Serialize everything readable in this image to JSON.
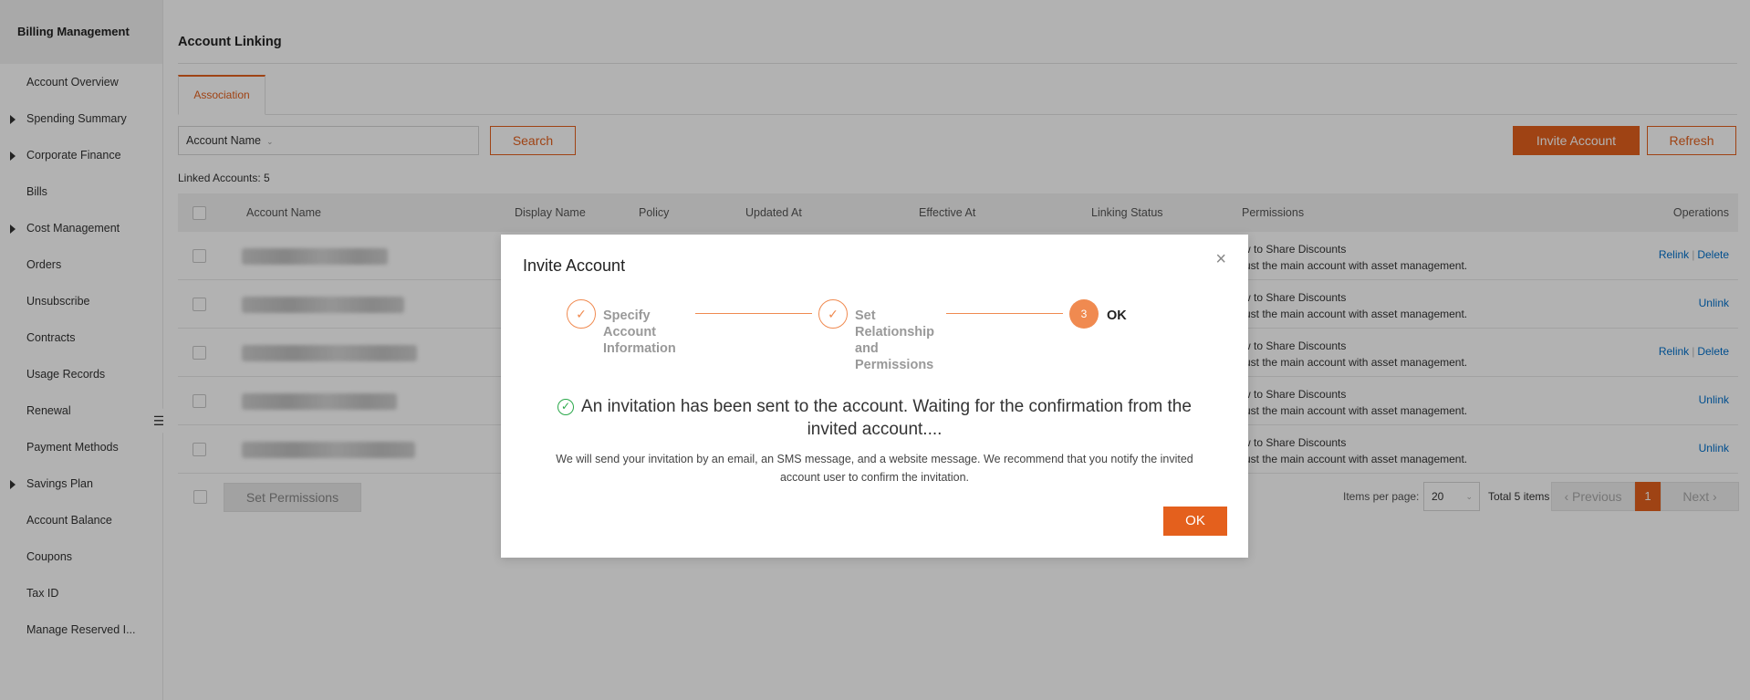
{
  "sidebar": {
    "title": "Billing Management",
    "items": [
      {
        "label": "Account Overview",
        "expandable": false
      },
      {
        "label": "Spending Summary",
        "expandable": true
      },
      {
        "label": "Corporate Finance",
        "expandable": true
      },
      {
        "label": "Bills",
        "expandable": false
      },
      {
        "label": "Cost Management",
        "expandable": true
      },
      {
        "label": "Orders",
        "expandable": false
      },
      {
        "label": "Unsubscribe",
        "expandable": false
      },
      {
        "label": "Contracts",
        "expandable": false
      },
      {
        "label": "Usage Records",
        "expandable": false
      },
      {
        "label": "Renewal",
        "expandable": false
      },
      {
        "label": "Payment Methods",
        "expandable": false
      },
      {
        "label": "Savings Plan",
        "expandable": true
      },
      {
        "label": "Account Balance",
        "expandable": false
      },
      {
        "label": "Coupons",
        "expandable": false
      },
      {
        "label": "Tax ID",
        "expandable": false
      },
      {
        "label": "Manage Reserved I...",
        "expandable": false
      }
    ]
  },
  "main": {
    "title": "Account Linking",
    "tab": "Association",
    "filter_select": "Account Name",
    "search_label": "Search",
    "invite_label": "Invite Account",
    "refresh_label": "Refresh",
    "linked_count": "Linked Accounts: 5",
    "columns": {
      "account_name": "Account Name",
      "display_name": "Display Name",
      "policy": "Policy",
      "updated_at": "Updated At",
      "effective_at": "Effective At",
      "linking_status": "Linking Status",
      "permissions": "Permissions",
      "operations": "Operations"
    },
    "rows": [
      {
        "perm1": "llow to Share Discounts",
        "perm2": "ntrust the main account with asset management.",
        "op1": "Relink",
        "op2": "Delete"
      },
      {
        "perm1": "llow to Share Discounts",
        "perm2": "ntrust the main account with asset management.",
        "op1": "Unlink",
        "op2": ""
      },
      {
        "perm1": "llow to Share Discounts",
        "perm2": "ntrust the main account with asset management.",
        "op1": "Relink",
        "op2": "Delete"
      },
      {
        "perm1": "llow to Share Discounts",
        "perm2": "ntrust the main account with asset management.",
        "op1": "Unlink",
        "op2": ""
      },
      {
        "perm1": "llow to Share Discounts",
        "perm2": "ntrust the main account with asset management.",
        "op1": "Unlink",
        "op2": ""
      }
    ],
    "set_permissions_label": "Set Permissions",
    "items_per_page_label": "Items per page:",
    "items_per_page_value": "20",
    "total_items": "Total 5 items",
    "prev_label": "Previous",
    "next_label": "Next",
    "current_page": "1"
  },
  "modal": {
    "title": "Invite Account",
    "close_glyph": "×",
    "steps": [
      {
        "label": "Specify Account Information",
        "state": "done"
      },
      {
        "label": "Set Relationship and Permissions",
        "state": "done"
      },
      {
        "label": "OK",
        "number": "3",
        "state": "current"
      }
    ],
    "message": "An invitation has been sent to the account. Waiting for the confirmation from the invited account....",
    "detail": "We will send your invitation by an email, an SMS message, and a website message. We recommend that you notify the invited account user to confirm the invitation.",
    "ok_label": "OK"
  },
  "colors": {
    "accent": "#e4601d",
    "step_accent": "#f08a50",
    "link": "#0070cc",
    "success": "#2aa84a"
  }
}
